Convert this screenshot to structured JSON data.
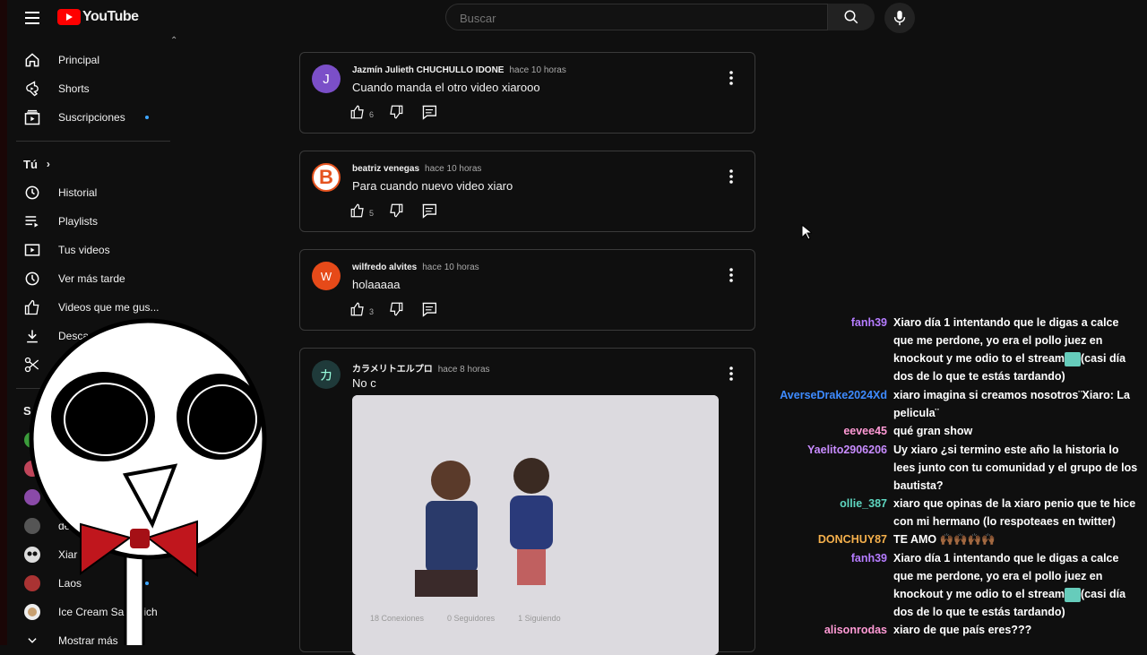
{
  "header": {
    "logo_text": "YouTube",
    "search_placeholder": "Buscar"
  },
  "sidebar": {
    "main": [
      {
        "label": "Principal",
        "icon": "home-icon"
      },
      {
        "label": "Shorts",
        "icon": "shorts-icon"
      },
      {
        "label": "Suscripciones",
        "icon": "subscriptions-icon"
      }
    ],
    "you_title": "Tú",
    "you": [
      {
        "label": "Historial",
        "icon": "history-icon"
      },
      {
        "label": "Playlists",
        "icon": "playlists-icon"
      },
      {
        "label": "Tus videos",
        "icon": "your-videos-icon"
      },
      {
        "label": "Ver más tarde",
        "icon": "watch-later-icon"
      },
      {
        "label": "Videos que me gus...",
        "icon": "liked-icon"
      },
      {
        "label": "Desca",
        "icon": "download-icon"
      }
    ],
    "subs_title": "S",
    "subs": [
      {
        "label": "dee"
      },
      {
        "label": "Xiar"
      },
      {
        "label": "Laos"
      },
      {
        "label": "Ice Cream Sandwich"
      }
    ],
    "more_label": "Mostrar más"
  },
  "comments": [
    {
      "author": "Jazmín Julieth CHUCHULLO IDONE",
      "time": "hace 10 horas",
      "text": "Cuando manda el otro video xiarooo",
      "likes": "6",
      "avatar_letter": "J",
      "avatar_color": "#7b4fc8"
    },
    {
      "author": "beatriz venegas",
      "time": "hace 10 horas",
      "text": "Para cuando nuevo video xiaro",
      "likes": "5",
      "avatar_letter": "B",
      "avatar_color": "#ffffff"
    },
    {
      "author": "wilfredo alvites",
      "time": "hace 10 horas",
      "text": "holaaaaa",
      "likes": "3",
      "avatar_letter": "W",
      "avatar_color": "#e64a19"
    },
    {
      "author": "カラメリトエルプロ",
      "time": "hace 8 horas",
      "text": "No c",
      "likes": "",
      "avatar_letter": "カ",
      "avatar_color": "#1f3a3a"
    }
  ],
  "embedded_image": {
    "stats": [
      "18 Conexiones",
      "0 Seguidores",
      "1 Siguiendo"
    ]
  },
  "chat": [
    {
      "user": "fanh39",
      "user_color": "#b57cff",
      "text": "Xiaro día 1 intentando que le digas a calce que me perdone, yo era el pollo juez en knockout y me odio to el stream",
      "text_tail": "(casi día dos de lo que te estás tardando)"
    },
    {
      "user": "AverseDrake2024Xd",
      "user_color": "#3e8bff",
      "text": "xiaro imagina si creamos nosotros¨Xiaro: La pelicula¨",
      "text_tail": ""
    },
    {
      "user": "eevee45",
      "user_color": "#ff9ad5",
      "text": "qué gran show",
      "text_tail": ""
    },
    {
      "user": "Yaelito2906206",
      "user_color": "#c88cff",
      "text": "Uy xiaro ¿si termino este año la historia lo lees junto con tu comunidad y el grupo de los bautista?",
      "text_tail": ""
    },
    {
      "user": "ollie_387",
      "user_color": "#5ed6c0",
      "text": "xiaro que opinas de la xiaro penio que te hice con mi hermano (lo respoteaes en twitter)",
      "text_tail": ""
    },
    {
      "user": "DONCHUY87",
      "user_color": "#f5b04c",
      "text": "TE AMO 🙌🏾🙌🏾🙌🏾🙌🏾",
      "text_tail": ""
    },
    {
      "user": "fanh39",
      "user_color": "#b57cff",
      "text": "Xiaro día 1 intentando que le digas a calce que me perdone, yo era el pollo juez en knockout y me odio to el stream",
      "text_tail": "(casi día dos de lo que te estás tardando)"
    },
    {
      "user": "alisonrodas",
      "user_color": "#ff9ad5",
      "text": "xiaro de que país eres???",
      "text_tail": ""
    }
  ]
}
